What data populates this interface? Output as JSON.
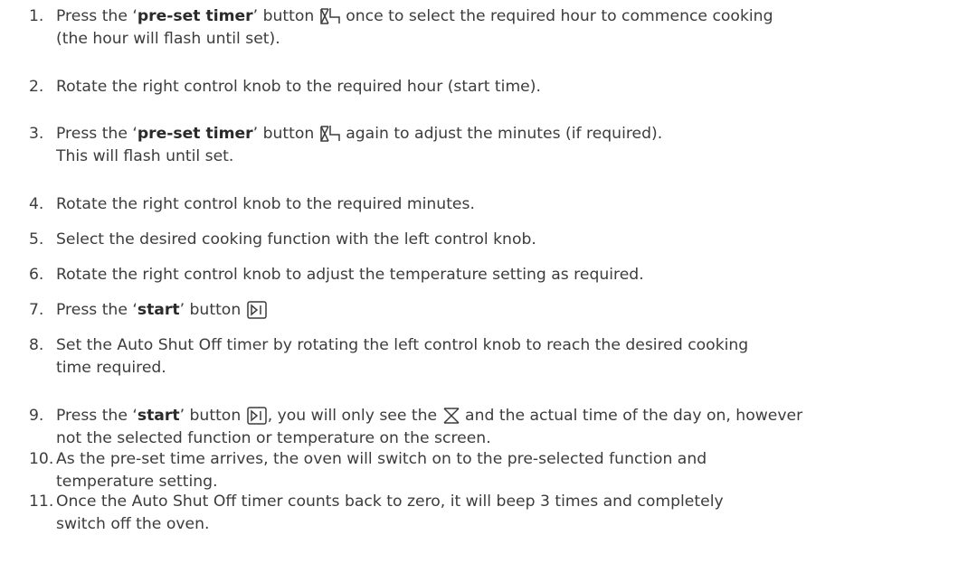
{
  "steps": [
    {
      "num": "1.",
      "lines": [
        {
          "pre": "Press the ‘",
          "bold": "pre-set timer",
          "post": "’ button",
          "icon": "preset-timer-icon",
          "after": " once to select the required hour to commence cooking"
        },
        {
          "text": "(the hour will flash until set)."
        }
      ]
    },
    {
      "num": "2.",
      "lines": [
        {
          "text": "Rotate the right control knob to the required hour (start time)."
        }
      ]
    },
    {
      "num": "3.",
      "lines": [
        {
          "pre": "Press the ‘",
          "bold": "pre-set timer",
          "post": "’ button",
          "icon": "preset-timer-icon",
          "after": " again to adjust the minutes (if required)."
        },
        {
          "text": "This will flash until set."
        }
      ]
    },
    {
      "num": "4.",
      "lines": [
        {
          "text": "Rotate the right control knob to the required minutes."
        }
      ]
    },
    {
      "num": "5.",
      "lines": [
        {
          "text": "Select the desired cooking function with the left control knob."
        }
      ]
    },
    {
      "num": "6.",
      "lines": [
        {
          "text": "Rotate the right control knob to adjust the temperature setting as required."
        }
      ]
    },
    {
      "num": "7.",
      "lines": [
        {
          "pre": "Press the ‘",
          "bold": "start",
          "post": "’ button",
          "icon": "start-button-icon",
          "after": ""
        }
      ]
    },
    {
      "num": "8.",
      "lines": [
        {
          "text": "Set the Auto Shut Off timer by rotating the left control knob to reach the desired cooking"
        },
        {
          "text": "time required."
        }
      ]
    },
    {
      "num": "9.",
      "lines": [
        {
          "pre": "Press the ‘",
          "bold": "start",
          "post": "’ button",
          "icon": "start-button-icon",
          "after": ",  you will only see the",
          "icon2": "hourglass-icon",
          "after2": " and the actual time of the day on, however"
        },
        {
          "text": "not the selected function or temperature on the screen."
        }
      ]
    },
    {
      "num": "10.",
      "lines": [
        {
          "text": "As the pre-set time arrives, the oven will switch on to the pre-selected function and"
        },
        {
          "text": "temperature setting."
        }
      ]
    },
    {
      "num": "11.",
      "lines": [
        {
          "text": "Once the Auto Shut Off timer counts back to zero, it will beep 3 times and completely"
        },
        {
          "text": "switch off the oven."
        }
      ]
    }
  ]
}
